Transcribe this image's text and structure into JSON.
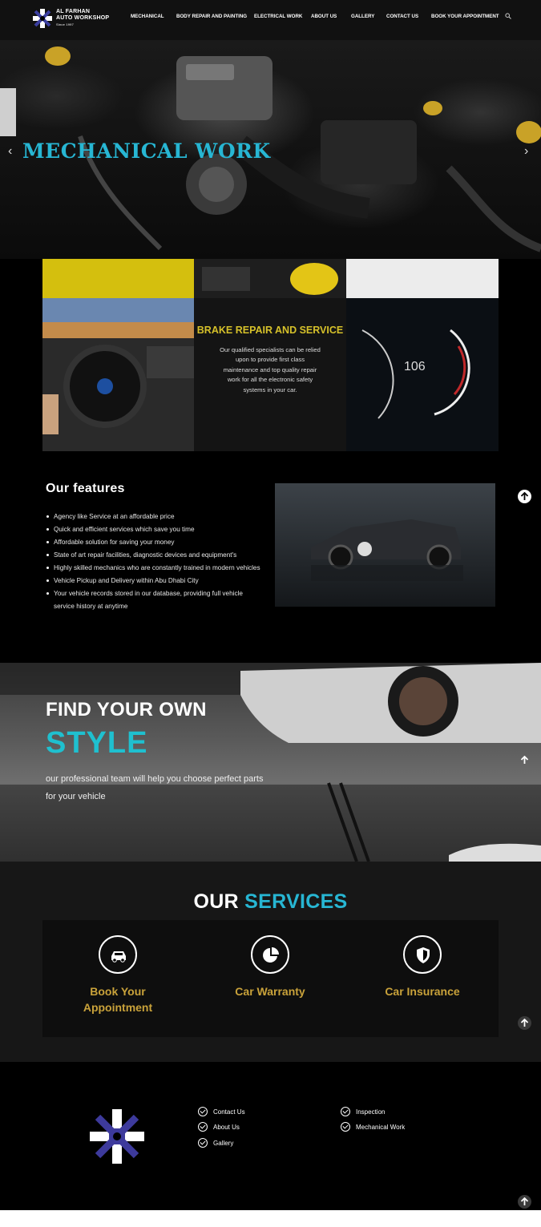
{
  "brand": {
    "name_line1": "AL FARHAN",
    "name_line2": "AUTO WORKSHOP",
    "since": "Since 1997"
  },
  "nav": {
    "items": [
      "MECHANICAL",
      "BODY REPAIR AND PAINTING",
      "ELECTRICAL WORK",
      "ABOUT US",
      "GALLERY",
      "CONTACT US",
      "BOOK YOUR APPOINTMENT"
    ],
    "search_icon": "search-icon"
  },
  "hero": {
    "title": "MECHANICAL WORK",
    "prev": "‹",
    "next": "›"
  },
  "grid": {
    "title": "BRAKE REPAIR AND SERVICE",
    "body": "Our qualified specialists can be relied upon to provide first class maintenance and top quality repair work for all the electronic safety systems in your car.",
    "speed": "106"
  },
  "features": {
    "title": "Our features",
    "items": [
      "Agency like Service at an affordable price",
      "Quick and efficient services which save you time",
      "Affordable solution for saving your money",
      "State of art repair facilities, diagnostic devices and equipment's",
      "Highly skilled mechanics who are constantly trained in modern vehicles",
      "Vehicle Pickup and Delivery within Abu Dhabi City",
      "Your vehicle records stored in our database, providing full vehicle service history at anytime"
    ]
  },
  "banner": {
    "line1": "FIND YOUR OWN",
    "line2": "STYLE",
    "text": "our professional team will help you choose perfect parts for your vehicle"
  },
  "services": {
    "title_a": "OUR ",
    "title_b": "SERVICES",
    "items": [
      {
        "label": "Book Your Appointment",
        "icon": "car-icon"
      },
      {
        "label": "Car Warranty",
        "icon": "pie-chart-icon"
      },
      {
        "label": "Car Insurance",
        "icon": "shield-icon"
      }
    ]
  },
  "footer": {
    "links_col1": [
      "Contact Us",
      "About Us",
      "Gallery"
    ],
    "links_col2": [
      "Inspection",
      "Mechanical Work"
    ]
  },
  "colors": {
    "accent": "#27b6d3",
    "gold": "#c9a23a",
    "yellow": "#d6c12a"
  }
}
